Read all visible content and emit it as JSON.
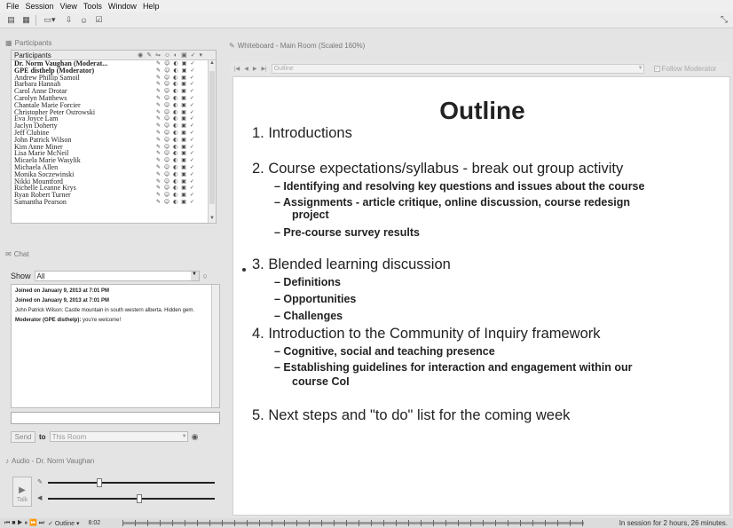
{
  "menu": [
    "File",
    "Session",
    "View",
    "Tools",
    "Window",
    "Help"
  ],
  "participants": {
    "panel_title": "Participants",
    "list_header": "Participants",
    "rows": [
      {
        "name": "Dr. Norm Vaughan (Moderat...",
        "bold": true
      },
      {
        "name": "GPE disthelp (Moderator)",
        "bold": true
      },
      {
        "name": "Andrew Phillip Samoil",
        "bold": false
      },
      {
        "name": "Barbara Hannah",
        "bold": false
      },
      {
        "name": "Carol Anne Drotar",
        "bold": false
      },
      {
        "name": "Carolyn Matthews",
        "bold": false
      },
      {
        "name": "Chantale Marie Forcier",
        "bold": false
      },
      {
        "name": "Christopher Peter Ostrowski",
        "bold": false
      },
      {
        "name": "Eva Joyce Lam",
        "bold": false
      },
      {
        "name": "Jaclyn Doherty",
        "bold": false
      },
      {
        "name": "Jeff Clubine",
        "bold": false
      },
      {
        "name": "John Patrick Wilson",
        "bold": false
      },
      {
        "name": "Kim Anne Miner",
        "bold": false
      },
      {
        "name": "Lisa Marie McNeil",
        "bold": false
      },
      {
        "name": "Micaela Marie Wasylik",
        "bold": false
      },
      {
        "name": "Michaela Allen",
        "bold": false
      },
      {
        "name": "Monika Soczewinski",
        "bold": false
      },
      {
        "name": "Nikki Mountford",
        "bold": false
      },
      {
        "name": "Richelle Leanne Krys",
        "bold": false
      },
      {
        "name": "Ryan Robert Turner",
        "bold": false
      },
      {
        "name": "Samantha Pearson",
        "bold": false
      }
    ]
  },
  "chat": {
    "panel_title": "Chat",
    "show_label": "Show",
    "show_value": "All",
    "messages": [
      {
        "text": "Joined on January 9, 2013 at 7:01 PM",
        "bold": true
      },
      {
        "text": "Joined on January 9, 2013 at 7:01 PM",
        "bold": true
      },
      {
        "text": "John Patrick Wilson: Castle mountain in south western alberta. Hidden gem.",
        "bold": false
      },
      {
        "text": "Moderator (GPE disthelp): you're welcome!",
        "bold": "partial",
        "prefix": "Moderator (GPE disthelp):",
        "rest": " you're welcome!"
      }
    ],
    "send_label": "Send",
    "to_label": "to",
    "to_value": "This Room"
  },
  "audio": {
    "panel_title": "Audio - Dr. Norm Vaughan",
    "talk_label": "Talk",
    "mic_level": 0.3,
    "speaker_level": 0.55
  },
  "whiteboard": {
    "panel_title": "Whiteboard - Main Room (Scaled 160%)",
    "page_value": "Outline",
    "follow_label": "Follow Moderator",
    "slide": {
      "title": "Outline",
      "items": [
        {
          "text": "1. Introductions",
          "subs": []
        },
        {
          "text": "2. Course expectations/syllabus - break out group activity",
          "subs": [
            "–  Identifying and resolving key questions and issues about the course",
            "–  Assignments - article critique, online discussion, course redesign",
            "project",
            "–  Pre-course survey results"
          ]
        },
        {
          "text": "3. Blended learning discussion",
          "subs": [
            "–  Definitions",
            "–  Opportunities",
            "–  Challenges"
          ]
        },
        {
          "text": "4. Introduction to the Community of Inquiry framework",
          "subs": [
            "–  Cognitive, social and teaching presence",
            "–  Establishing guidelines for interaction and engagement within our",
            "course CoI"
          ]
        },
        {
          "text": "5. Next steps and \"to do\" list for the coming week",
          "subs": []
        }
      ]
    }
  },
  "status": {
    "page_label": "Outline",
    "time": "8:02",
    "session_text": "In session for 2 hours, 26 minutes."
  }
}
